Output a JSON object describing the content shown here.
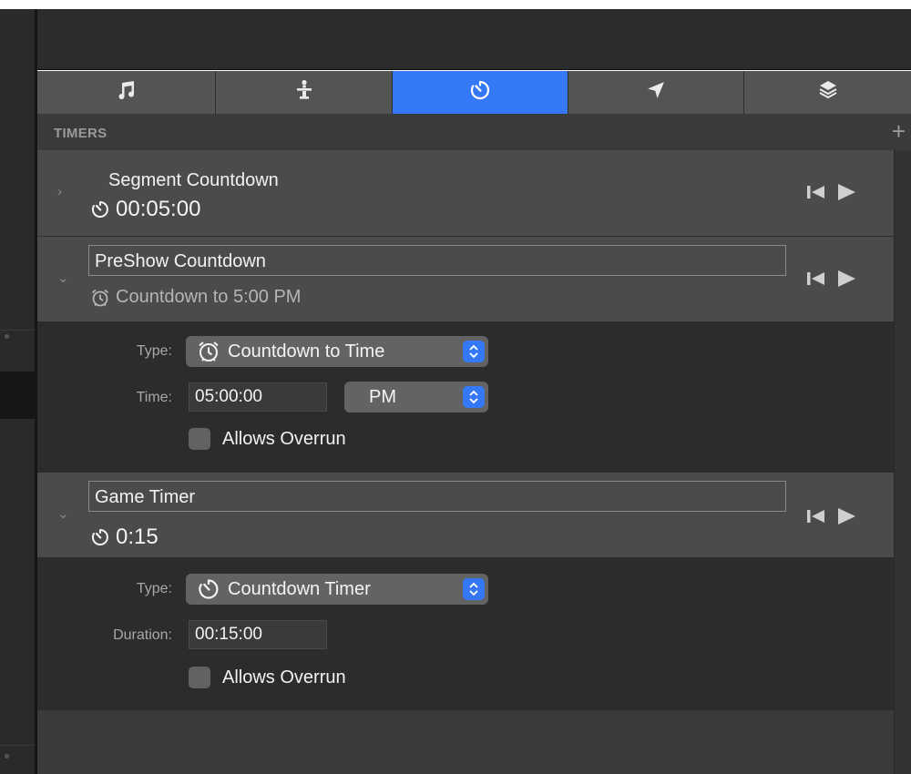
{
  "tabs": [
    {
      "icon": "music-note-icon",
      "width": 196
    },
    {
      "icon": "presenter-icon",
      "width": 194
    },
    {
      "icon": "timer-icon",
      "width": 193,
      "active": true
    },
    {
      "icon": "location-arrow-icon",
      "width": 193
    },
    {
      "icon": "layers-icon",
      "width": 183
    }
  ],
  "panel": {
    "title": "TIMERS",
    "add_label": "+"
  },
  "timers": [
    {
      "name": "Segment Countdown",
      "value": "00:05:00",
      "icon": "timer-icon",
      "expanded": false
    },
    {
      "name": "PreShow Countdown",
      "value": "Countdown to 5:00 PM",
      "icon": "alarm-clock-icon",
      "expanded": true,
      "detail": {
        "type_label": "Type:",
        "type_value": "Countdown to Time",
        "time_label": "Time:",
        "time_value": "05:00:00",
        "ampm_value": "PM",
        "overrun_label": "Allows Overrun"
      }
    },
    {
      "name": "Game Timer",
      "value": "0:15",
      "icon": "timer-icon",
      "expanded": true,
      "detail": {
        "type_label": "Type:",
        "type_value": "Countdown Timer",
        "duration_label": "Duration:",
        "duration_value": "00:15:00",
        "overrun_label": "Allows Overrun"
      }
    }
  ],
  "colors": {
    "accent": "#3478f6",
    "row_bg": "#4b4b4b",
    "detail_bg": "#2c2c2c"
  }
}
